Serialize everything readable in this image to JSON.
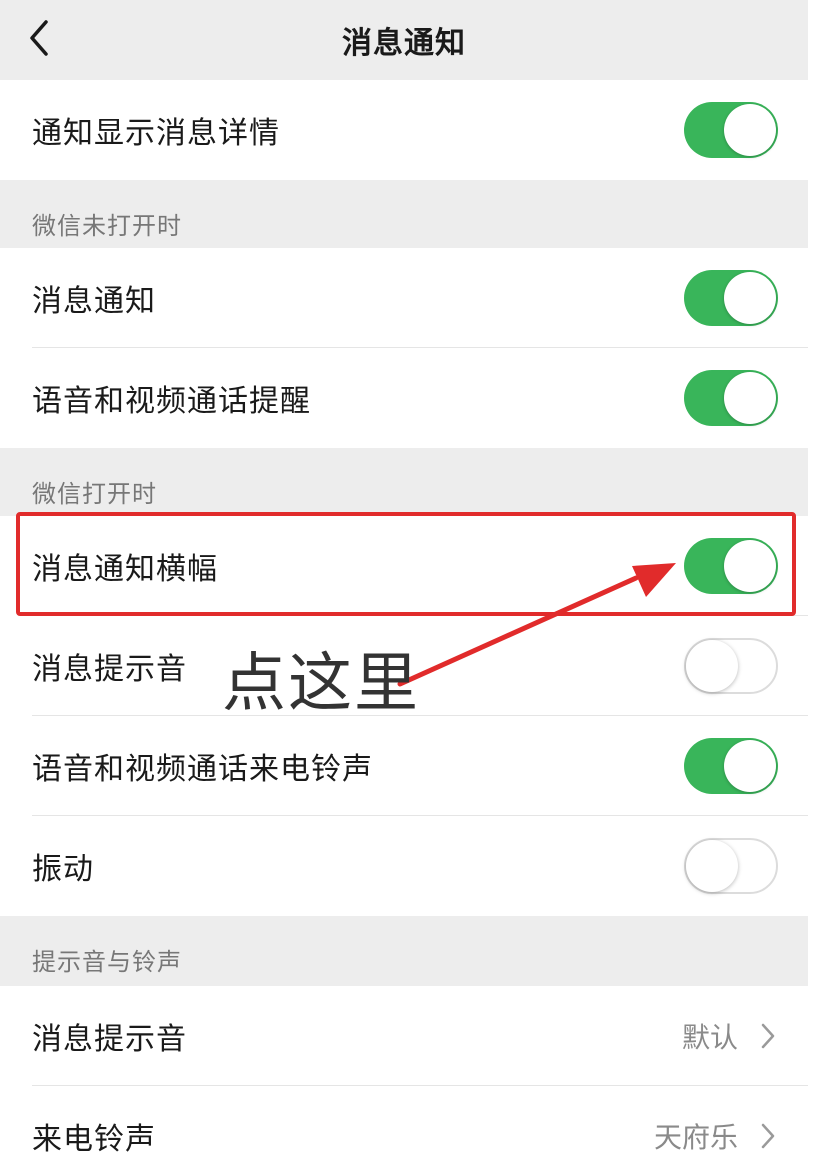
{
  "navbar": {
    "title": "消息通知",
    "back_icon": "chevron-left-icon"
  },
  "rows": {
    "show_details": {
      "label": "通知显示消息详情",
      "toggle": "on"
    },
    "closed_notify": {
      "label": "消息通知",
      "toggle": "on"
    },
    "closed_call_remind": {
      "label": "语音和视频通话提醒",
      "toggle": "on"
    },
    "open_banner": {
      "label": "消息通知横幅",
      "toggle": "on"
    },
    "open_sound": {
      "label": "消息提示音",
      "toggle": "off"
    },
    "open_ringtone": {
      "label": "语音和视频通话来电铃声",
      "toggle": "on"
    },
    "open_vibrate": {
      "label": "振动",
      "toggle": "off"
    },
    "sound_message": {
      "label": "消息提示音",
      "value": "默认"
    },
    "sound_ringtone": {
      "label": "来电铃声",
      "value": "天府乐"
    }
  },
  "sections": {
    "closed": "微信未打开时",
    "opened": "微信打开时",
    "sounds": "提示音与铃声"
  },
  "annotation": {
    "text": "点这里",
    "color": "#e12b2b"
  },
  "colors": {
    "toggle_on": "#39b55a",
    "background": "#ededed"
  }
}
